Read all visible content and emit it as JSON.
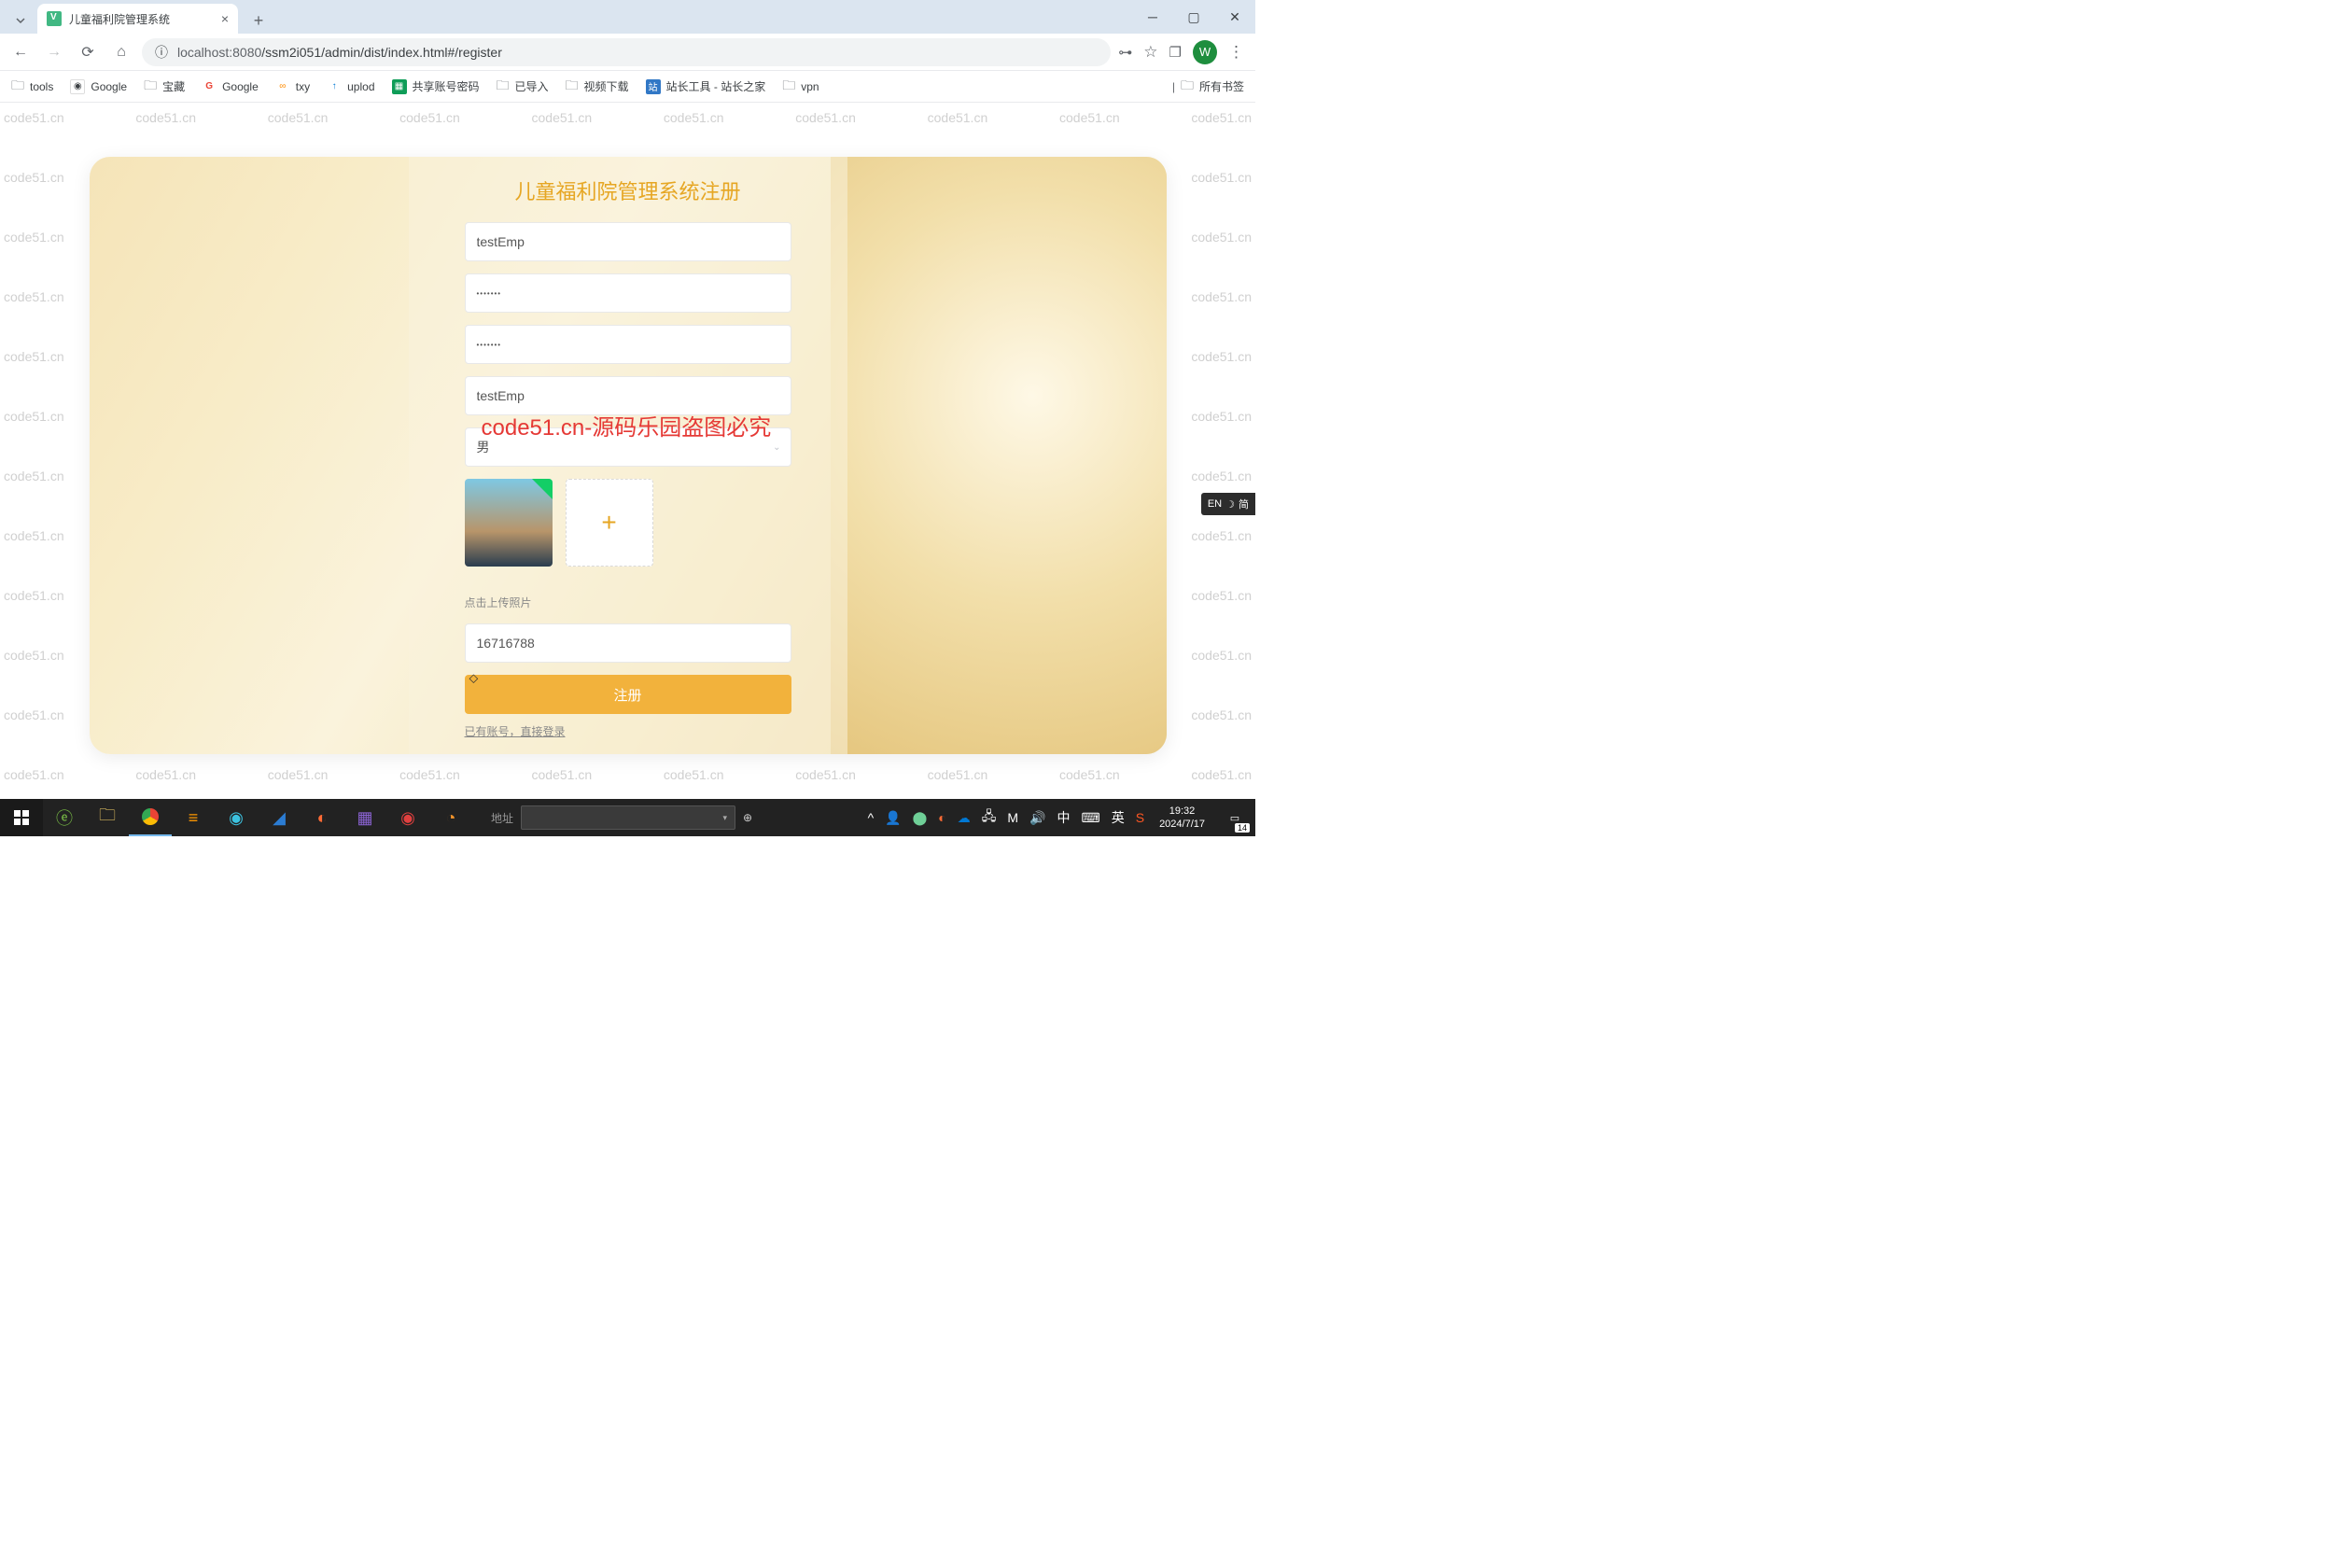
{
  "browser": {
    "tab_title": "儿童福利院管理系统",
    "url_host": "localhost:8080",
    "url_path": "/ssm2i051/admin/dist/index.html#/register",
    "avatar_letter": "W"
  },
  "bookmarks": [
    {
      "label": "tools",
      "icon": "folder"
    },
    {
      "label": "Google",
      "icon": "google"
    },
    {
      "label": "宝藏",
      "icon": "folder"
    },
    {
      "label": "Google",
      "icon": "google-g"
    },
    {
      "label": "txy",
      "icon": "cloud"
    },
    {
      "label": "uplod",
      "icon": "upload"
    },
    {
      "label": "共享账号密码",
      "icon": "sheet"
    },
    {
      "label": "已导入",
      "icon": "folder"
    },
    {
      "label": "视频下载",
      "icon": "folder"
    },
    {
      "label": "站长工具 - 站长之家",
      "icon": "tool"
    },
    {
      "label": "vpn",
      "icon": "folder"
    }
  ],
  "all_bookmarks_label": "所有书签",
  "watermark_text": "code51.cn",
  "red_watermark": "code51.cn-源码乐园盗图必究",
  "form": {
    "title": "儿童福利院管理系统注册",
    "username_value": "testEmp",
    "password_value": "•••••••",
    "confirm_value": "•••••••",
    "nickname_value": "testEmp",
    "gender_value": "男",
    "upload_hint": "点击上传照片",
    "phone_value": "16716788",
    "submit_label": "注册",
    "login_link": "已有账号，直接登录"
  },
  "ime": {
    "lang": "EN",
    "mode": "简"
  },
  "taskbar": {
    "search_label": "地址",
    "tray_ime_cn": "中",
    "tray_ime_en": "英",
    "time": "19:32",
    "date": "2024/7/17",
    "notif_count": "14"
  }
}
